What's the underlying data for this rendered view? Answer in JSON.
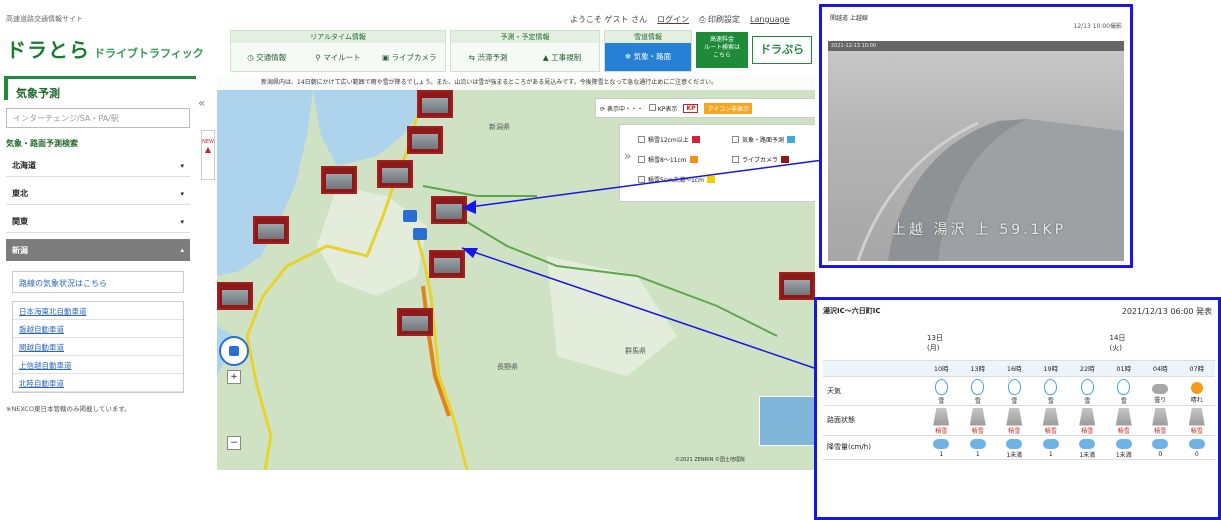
{
  "header": {
    "site_title": "高速道路交通情報サイト",
    "logo": "ドラとら",
    "logo_en": "ドライブトラフィック",
    "welcome": "ようこそ ゲスト さん",
    "login": "ログイン",
    "print": "印刷設定",
    "language": "Language",
    "realtime": {
      "title": "リアルタイム情報",
      "items": [
        "交通情報",
        "マイルート",
        "ライブカメラ"
      ]
    },
    "forecast": {
      "title": "予測・予定情報",
      "items": [
        "渋滞予測",
        "工事規制"
      ]
    },
    "weather": {
      "title": "雪道情報",
      "item": "気象・路面"
    },
    "highway_button": "高速料金\nルート検索は\nこちら",
    "drapura": "ドラぷら"
  },
  "sidebar": {
    "heading": "気象予測",
    "search_placeholder": "インターチェンジ/SA・PA/駅",
    "subheading": "気象・路面予測検索",
    "regions": [
      {
        "label": "北海道",
        "active": false
      },
      {
        "label": "東北",
        "active": false
      },
      {
        "label": "関東",
        "active": false
      },
      {
        "label": "新潟",
        "active": true
      }
    ],
    "info_link": "路線の気象状況はこちら",
    "routes": [
      "日本海東北自動車道",
      "磐越自動車道",
      "関越自動車道",
      "上信越自動車道",
      "北陸自動車道"
    ],
    "note": "※NEXCO東日本管轄のみ掲載しています。",
    "collapse_icon": "«",
    "new_tab": "NEW"
  },
  "map": {
    "banner": "新潟県内は、14日朝にかけて広い範囲で雨や雪が降るでしょう。また、山沿いは雪が強まるところがある見込みです。今後降雪となって急な通行止めにご注意ください。",
    "top_controls": {
      "refresh": "表示中・・・",
      "kp_label": "KP表示",
      "kp": "KP",
      "icon_toggle": "アイコン非表示"
    },
    "legend_items": [
      "積雪12cm以上",
      "積雪8〜11cm",
      "積雪5cm未満〜1cm",
      "気象・路面予測",
      "ライブカメラ"
    ],
    "labels": {
      "pref_niigata": "新潟県",
      "pref_nagano": "長野県",
      "pref_gunma": "群馬県"
    },
    "copyright": "©2021 ZENRIN ©国土地理院"
  },
  "camera_panel": {
    "title": "関越道 上越線",
    "time": "12/13 10:00撮影",
    "overlay": "2021-12-13 10:00",
    "caption": "上越 湯沢 上 59.1KP"
  },
  "forecast_panel": {
    "title": "湯沢IC〜六日町IC",
    "published": "2021/12/13 06:00 発表",
    "days": [
      {
        "date": "13日",
        "dow": "(月)"
      },
      {
        "date": "14日",
        "dow": "(火)"
      }
    ],
    "hours": [
      "10時",
      "13時",
      "16時",
      "19時",
      "22時",
      "01時",
      "04時",
      "07時"
    ],
    "rows": {
      "weather": {
        "label": "天気",
        "values": [
          "雪",
          "雪",
          "雪",
          "雪",
          "雪",
          "雪",
          "曇り",
          "晴れ"
        ]
      },
      "road": {
        "label": "路面状態",
        "values": [
          "積雪",
          "積雪",
          "積雪",
          "積雪",
          "積雪",
          "積雪",
          "積雪",
          "積雪"
        ]
      },
      "snow": {
        "label": "降雪量(cm/h)",
        "values": [
          "1",
          "1",
          "1未満",
          "1",
          "1未満",
          "1未満",
          "0",
          "0"
        ]
      }
    }
  },
  "colors": {
    "accent_green": "#1e8a3a",
    "highlight_blue": "#1616e6",
    "camera_red": "#8c1a1a"
  }
}
